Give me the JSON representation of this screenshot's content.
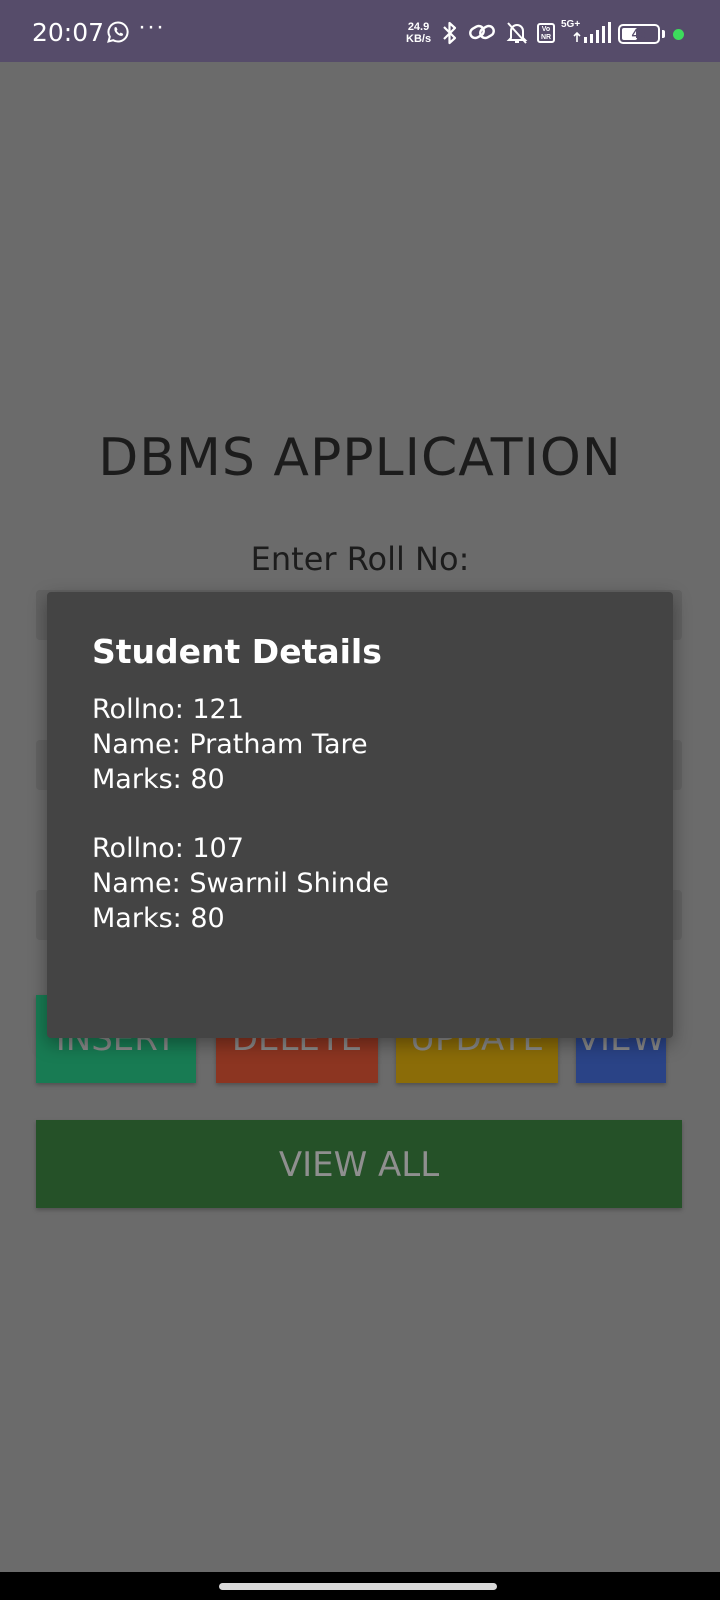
{
  "status_bar": {
    "time": "20:07",
    "net_speed_value": "24.9",
    "net_speed_unit": "KB/s",
    "volte_label": "Vo NR",
    "network_label": "5G+",
    "battery_level": "45",
    "icons": [
      "whatsapp-icon",
      "more-icon",
      "bluetooth-icon",
      "link-icon",
      "bell-off-icon",
      "volte-icon",
      "signal-icon",
      "battery-icon"
    ]
  },
  "app": {
    "title": "DBMS APPLICATION",
    "roll_label": "Enter Roll No:",
    "buttons": {
      "insert": "INSERT",
      "delete": "DELETE",
      "update": "UPDATE",
      "view": "VIEW",
      "view_all": "VIEW ALL"
    }
  },
  "dialog": {
    "title": "Student Details",
    "records": [
      {
        "rollno": "Rollno: 121",
        "name": "Name: Pratham Tare",
        "marks": "Marks: 80"
      },
      {
        "rollno": "Rollno: 107",
        "name": "Name: Swarnil Shinde",
        "marks": "Marks: 80"
      }
    ]
  },
  "colors": {
    "status_bar": "#564c6a",
    "scrim_background": "#6b6b6b",
    "dialog_background": "#444444",
    "insert_button": "#187b53",
    "delete_button": "#8c3521",
    "update_button": "#8b6c08",
    "view_button": "#2a4386",
    "view_all_button": "#255128"
  }
}
